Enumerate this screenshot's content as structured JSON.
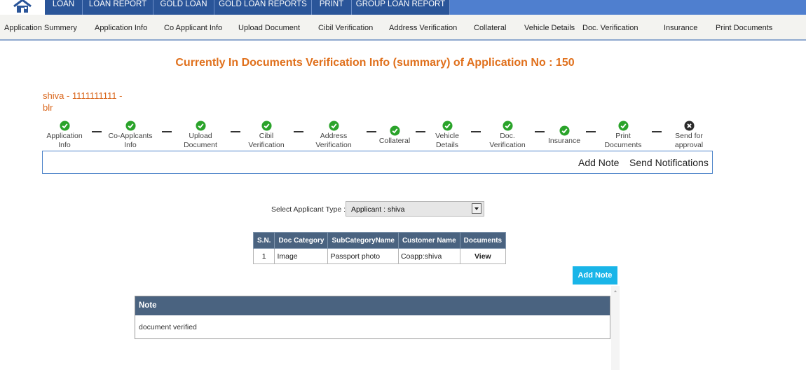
{
  "topnav": {
    "items": [
      "LOAN",
      "LOAN REPORT",
      "GOLD LOAN",
      "GOLD LOAN REPORTS",
      "PRINT",
      "GROUP LOAN REPORT"
    ]
  },
  "subnav": {
    "items": [
      "Application Summery",
      "Application Info",
      "Co Applicant Info",
      "Upload Document",
      "Cibil Verification",
      "Address Verification",
      "Collateral",
      "Vehicle Details",
      "Doc. Verification",
      "Insurance",
      "Print Documents"
    ]
  },
  "page": {
    "title": "Currently In Documents Verification Info (summary) of Application No : 150",
    "applicant_line1": "shiva - 1111111111 -",
    "applicant_line2": "blr"
  },
  "steps": [
    {
      "l1": "Application",
      "l2": "Info",
      "status": "done"
    },
    {
      "l1": "Co-Applcants",
      "l2": "Info",
      "status": "done"
    },
    {
      "l1": "Upload",
      "l2": "Document",
      "status": "done"
    },
    {
      "l1": "Cibil",
      "l2": "Verification",
      "status": "done"
    },
    {
      "l1": "Address",
      "l2": "Verification",
      "status": "done"
    },
    {
      "l1": "Collateral",
      "l2": "",
      "status": "done"
    },
    {
      "l1": "Vehicle",
      "l2": "Details",
      "status": "done"
    },
    {
      "l1": "Doc.",
      "l2": "Verification",
      "status": "done"
    },
    {
      "l1": "Insurance",
      "l2": "",
      "status": "done"
    },
    {
      "l1": "Print",
      "l2": "Documents",
      "status": "done"
    },
    {
      "l1": "Send for",
      "l2": "approval",
      "status": "pending"
    }
  ],
  "actions": {
    "add_note": "Add Note",
    "send_notifications": "Send Notifications"
  },
  "select": {
    "label": "Select Applicant Type :",
    "value": "Applicant : shiva"
  },
  "table": {
    "headers": [
      "S.N.",
      "Doc Category",
      "SubCategoryName",
      "Customer Name",
      "Documents"
    ],
    "rows": [
      [
        "1",
        "Image",
        "Passport photo",
        "Coapp:shiva",
        "View"
      ]
    ]
  },
  "add_note_button": "Add Note",
  "note": {
    "header": "Note",
    "text": "document verified"
  },
  "colors": {
    "done": "#2aa32a",
    "pending": "#2b2b2b",
    "accent": "#e0701c",
    "nav": "#2a5599",
    "table_header": "#4a6380",
    "button": "#19b5e8"
  }
}
